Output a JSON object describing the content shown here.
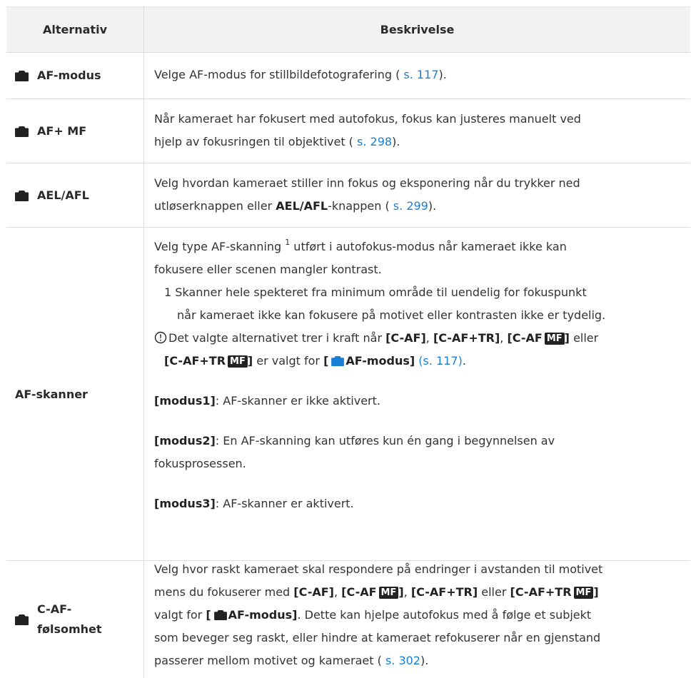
{
  "table": {
    "headers": {
      "col1": "Alternativ",
      "col2": "Beskrivelse"
    },
    "rows": [
      {
        "label": "AF-modus",
        "text": "Velge AF-modus for stillbildefotografering (",
        "link": " s. 117",
        "tail": ")."
      },
      {
        "label": "AF+ MF",
        "line1": "Når kameraet har fokusert med autofokus, fokus kan justeres manuelt ved",
        "line2": "hjelp av fokusringen til objektivet (",
        "link": " s. 298",
        "tail": ")."
      },
      {
        "label": "AEL/AFL",
        "line1": "Velg hvordan kameraet stiller inn fokus og eksponering når du trykker ned",
        "line2a": "utløserknappen eller ",
        "bold": "AEL/AFL",
        "line2b": "-knappen (",
        "link": " s. 299",
        "tail": ")."
      },
      {
        "label": "AF-skanner",
        "p1a": "Velg type AF-skanning ",
        "p1sup": "1",
        "p1b": " utført i autofokus-modus når kameraet ikke kan",
        "p1c": "fokusere eller scenen mangler kontrast.",
        "fn1": "1  Skanner hele spekteret fra minimum område til uendelig for fokuspunkt",
        "fn2": "når kameraet ikke kan fokusere på motivet eller kontrasten ikke er tydelig.",
        "note_a": "Det valgte alternativet trer i kraft når ",
        "note_caf": "[C-AF]",
        "note_sep1": ", ",
        "note_caftr": "[C-AF+TR]",
        "note_sep2": ", ",
        "note_cafmf": "[C-AF",
        "note_mf": "MF",
        "note_close": "]",
        "note_eller": " eller",
        "note_l2a": "[C-AF+TR",
        "note_l2mf": "MF",
        "note_l2close": "]",
        "note_l2b": " er valgt for ",
        "note_link": "[  AF-modus]",
        "note_link2": " (s. 117)",
        "note_end": ".",
        "m1": "[modus1]",
        "m1t": ": AF-skanner er ikke aktivert.",
        "m2": "[modus2]",
        "m2t": ": En AF-skanning kan utføres kun én gang i begynnelsen av",
        "m2t2": "fokusprosessen.",
        "m3": "[modus3]",
        "m3t": ": AF-skanner er aktivert."
      },
      {
        "label1": "C-AF-",
        "label2": "følsomhet",
        "l1": "Velg hvor raskt kameraet skal respondere på endringer i avstanden til motivet",
        "l2a": "mens du fokuserer med ",
        "caf": "[C-AF]",
        "sep1": ", ",
        "cafmf": "[C-AF",
        "mf": "MF",
        "close": "]",
        "sep2": ", ",
        "caftr": "[C-AF+TR]",
        "eller": " eller ",
        "caftrmf": "[C-AF+TR",
        "mf2": "MF",
        "close2": "]",
        "l3a": "valgt for ",
        "l3b": "[  AF-modus]",
        "l3c": ". Dette kan hjelpe autofokus med å følge et subjekt",
        "l4": "som beveger seg raskt, eller hindre at kameraet refokuserer når en gjenstand",
        "l5a": "passerer mellom motivet og kameraet (",
        "link": " s. 302",
        "tail": ")."
      }
    ]
  },
  "colors": {
    "link": "#1a7fd4",
    "border": "#dcdcdc",
    "header_bg": "#f2f2f2"
  },
  "icons": [
    "camera-icon",
    "caution-icon"
  ]
}
